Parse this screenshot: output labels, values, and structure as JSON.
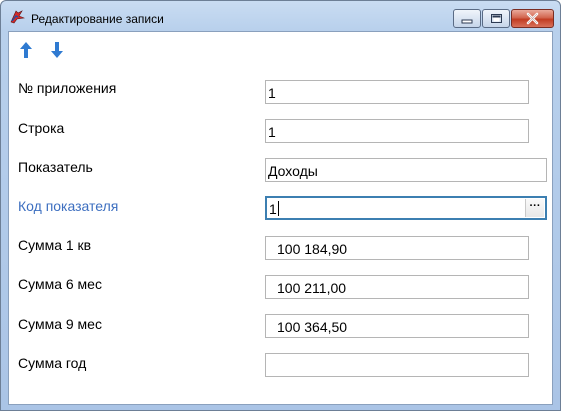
{
  "window": {
    "title": "Редактирование записи"
  },
  "toolbar": {
    "up_icon": "arrow-up-icon",
    "down_icon": "arrow-down-icon"
  },
  "form": {
    "fields": [
      {
        "label": "№ приложения",
        "value": "1"
      },
      {
        "label": "Строка",
        "value": "1"
      },
      {
        "label": "Показатель",
        "value": "Доходы"
      },
      {
        "label": "Код показателя",
        "value": "1",
        "ellipsis_label": "···"
      },
      {
        "label": "Сумма 1 кв",
        "value": "100 184,90"
      },
      {
        "label": "Сумма 6 мес",
        "value": "100 211,00"
      },
      {
        "label": "Сумма 9 мес",
        "value": "100 364,50"
      },
      {
        "label": "Сумма год",
        "value": ""
      }
    ]
  },
  "colors": {
    "focused_label": "#3d6fc0",
    "arrow": "#2f7ad1",
    "close_button": "#c23c22"
  }
}
